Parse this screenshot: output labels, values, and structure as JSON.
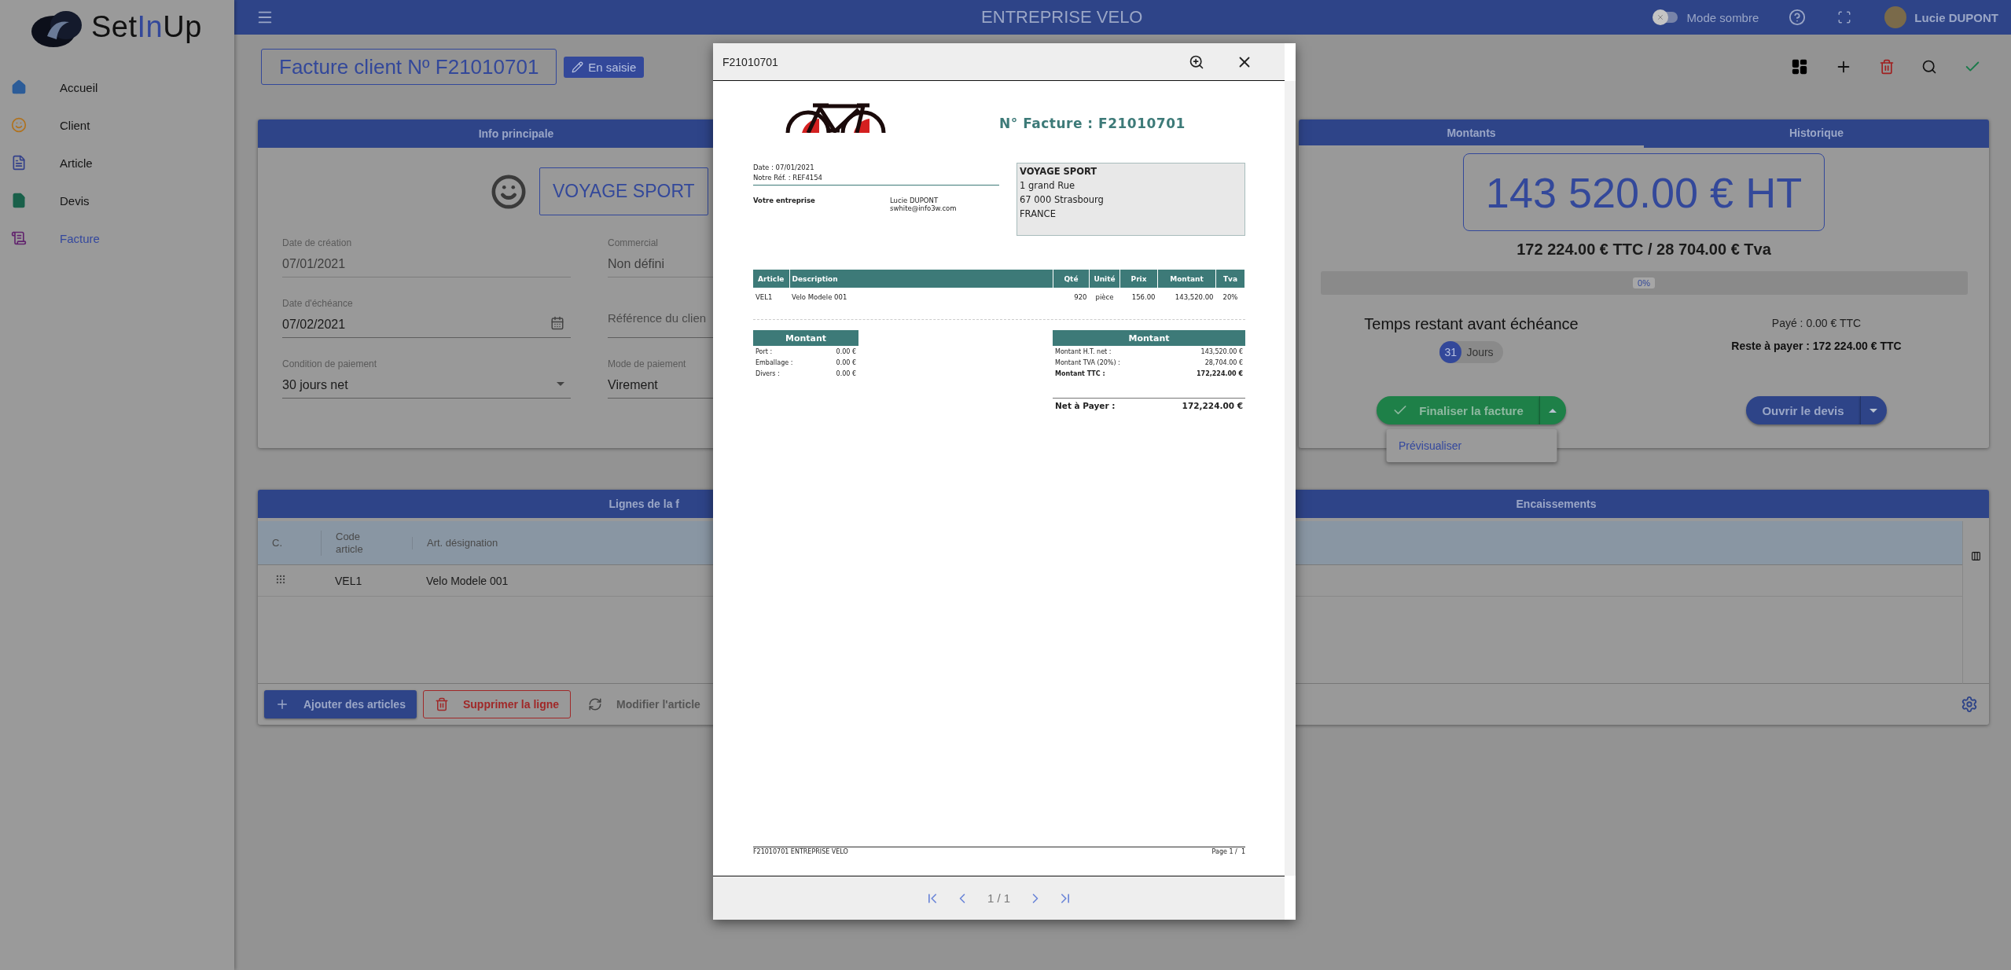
{
  "logo": {
    "parts": [
      {
        "text": "Set",
        "highlight": false
      },
      {
        "text": "In",
        "highlight": true
      },
      {
        "text": "Up",
        "highlight": false
      }
    ]
  },
  "sidebar": {
    "items": [
      {
        "label": "Accueil",
        "selected": false
      },
      {
        "label": "Client",
        "selected": false
      },
      {
        "label": "Article",
        "selected": false
      },
      {
        "label": "Devis",
        "selected": false
      },
      {
        "label": "Facture",
        "selected": true
      }
    ]
  },
  "header": {
    "title": "ENTREPRISE VELO",
    "dark_mode": {
      "label": "Mode sombre",
      "on": false
    },
    "user": {
      "name": "Lucie DUPONT"
    }
  },
  "invoice": {
    "title": "Facture client Nº F21010701",
    "status": "En saisie"
  },
  "info_panel": {
    "title": "Info principale",
    "client": "VOYAGE SPORT",
    "fields": [
      {
        "kind": "text",
        "label": "Date de création",
        "value": "07/01/2021",
        "disabled": true
      },
      {
        "kind": "text",
        "label": "Commercial",
        "value": "Non défini",
        "disabled": true
      },
      {
        "kind": "date",
        "label": "Date d'échéance",
        "value": "07/02/2021",
        "disabled": false
      },
      {
        "kind": "text",
        "placeholder": "Référence du clien",
        "disabled": false
      },
      {
        "kind": "select",
        "label": "Condition de paiement",
        "value": "30 jours net",
        "disabled": false
      },
      {
        "kind": "text",
        "label": "Mode de paiement",
        "value": "Virement",
        "disabled": false
      }
    ]
  },
  "amounts_panel": {
    "tabs": [
      {
        "label": "Montants",
        "selected": true
      },
      {
        "label": "Historique",
        "selected": false
      }
    ],
    "total_ht": "143 520.00 € HT",
    "totals": "172 224.00 € TTC / 28 704.00 € Tva",
    "progress": {
      "level": 0,
      "label": "0%"
    },
    "deadline": {
      "title": "Temps restant avant échéance",
      "days": "31",
      "unit": "Jours"
    },
    "paid": "Payé : 0.00 € TTC",
    "remaining": "Reste à payer : 172 224.00 € TTC",
    "actions": [
      {
        "kind": "success",
        "label": "Finaliser la facture",
        "expanded": true,
        "menu": [
          "Prévisualiser"
        ]
      },
      {
        "kind": "primary",
        "label": "Ouvrir le devis",
        "expanded": false
      }
    ]
  },
  "lines_panel": {
    "titles": [
      "Lignes de la f",
      "Encaissements"
    ],
    "columns": [
      "C.",
      "Code article",
      "Art. désignation"
    ],
    "rows": [
      {
        "code": "VEL1",
        "designation": "Velo Modele 001"
      }
    ],
    "buttons": [
      {
        "kind": "primary",
        "label": "Ajouter des articles"
      },
      {
        "kind": "danger",
        "label": "Supprimer la ligne"
      },
      {
        "kind": "plain",
        "label": "Modifier l'article"
      }
    ]
  },
  "preview": {
    "title": "F21010701",
    "pager": "1 / 1",
    "document": {
      "number": "N° Facture : F21010701",
      "meta": [
        "Date : 07/01/2021",
        "Notre Réf. : REF4154"
      ],
      "sender": {
        "label": "Votre entreprise",
        "contact": [
          "Lucie DUPONT",
          "swhite@info3w.com"
        ]
      },
      "recipient": [
        "VOYAGE SPORT",
        "1 grand Rue",
        "67 000 Strasbourg",
        "FRANCE"
      ],
      "columns": [
        "Article",
        "Description",
        "Qté",
        "Unité",
        "Prix",
        "Montant",
        "Tva"
      ],
      "rows": [
        [
          "VEL1",
          "Velo Modele 001",
          "920",
          "pièce",
          "156.00",
          "143,520.00",
          "20%"
        ]
      ],
      "charges": {
        "title": "Montant",
        "rows": [
          {
            "label": "Port :",
            "value": "0.00 €",
            "bold": false
          },
          {
            "label": "Emballage :",
            "value": "0.00 €",
            "bold": false
          },
          {
            "label": "Divers :",
            "value": "0.00 €",
            "bold": false
          }
        ]
      },
      "totals": {
        "title": "Montant",
        "rows": [
          {
            "label": "Montant H.T. net :",
            "value": "143,520.00 €",
            "bold": false
          },
          {
            "label": "Montant TVA (20%) :",
            "value": "28,704.00 €",
            "bold": false
          },
          {
            "label": "Montant TTC :",
            "value": "172,224.00 €",
            "bold": true
          }
        ]
      },
      "net": {
        "label": "Net à Payer :",
        "value": "172,224.00 €"
      },
      "footer": {
        "left": "F21010701 ENTREPRISE VELO",
        "right": "Page 1 /  1"
      }
    }
  }
}
